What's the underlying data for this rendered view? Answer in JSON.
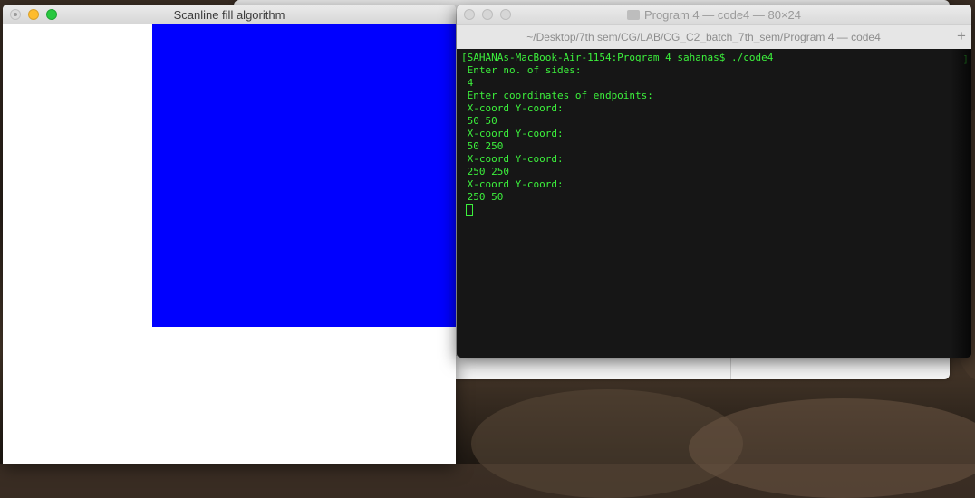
{
  "gl_window": {
    "title": "Scanline fill algorithm",
    "fill_color": "#0000ff"
  },
  "terminal": {
    "title": "Program 4 — code4 — 80×24",
    "tab_path": "~/Desktop/7th sem/CG/LAB/CG_C2_batch_7th_sem/Program 4 — code4",
    "new_tab_label": "+",
    "lines": [
      "[SAHANAs-MacBook-Air-1154:Program 4 sahanas$ ./code4",
      " Enter no. of sides:",
      " 4",
      " Enter coordinates of endpoints:",
      " X-coord Y-coord:",
      " 50 50",
      " X-coord Y-coord:",
      " 50 250",
      " X-coord Y-coord:",
      " 250 250",
      " X-coord Y-coord:",
      " 250 50"
    ],
    "text_color": "#3cf03c"
  }
}
